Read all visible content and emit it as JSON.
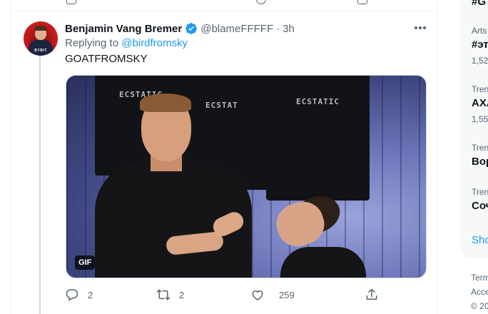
{
  "tweet": {
    "display_name": "Benjamin Vang Bremer",
    "handle": "@blameFFFFF",
    "separator": "·",
    "time": "3h",
    "replying_prefix": "Replying to",
    "replying_to": "@birdfromsky",
    "text": "GOATFROMSKY",
    "avatar_tag": "BYBIT",
    "media": {
      "badge": "GIF",
      "shirt_text_1": "ECSTATIC",
      "shirt_text_2": "ECSTAT",
      "shirt_text_3": "ECSTATIC"
    },
    "actions": {
      "reply_count": "2",
      "retweet_count": "2",
      "like_count": "259"
    }
  },
  "sidebar": {
    "top_fragment": "#G",
    "trends": [
      {
        "category": "Arts",
        "title": "#эт",
        "count": "1,52"
      },
      {
        "category": "Tren",
        "title": "АХА",
        "count": "1,55"
      },
      {
        "category": "Tren",
        "title": "Вор",
        "count": ""
      },
      {
        "category": "Tren",
        "title": "Соч",
        "count": ""
      }
    ],
    "show_more": "Sho"
  },
  "footer": {
    "line1": "Term",
    "line2": "Acce",
    "line3": "© 20"
  },
  "colors": {
    "accent": "#1d9bf0",
    "text_primary": "#0f1419",
    "text_secondary": "#536471",
    "border": "#eff3f4",
    "sidebar_bg": "#f7f9f9"
  }
}
